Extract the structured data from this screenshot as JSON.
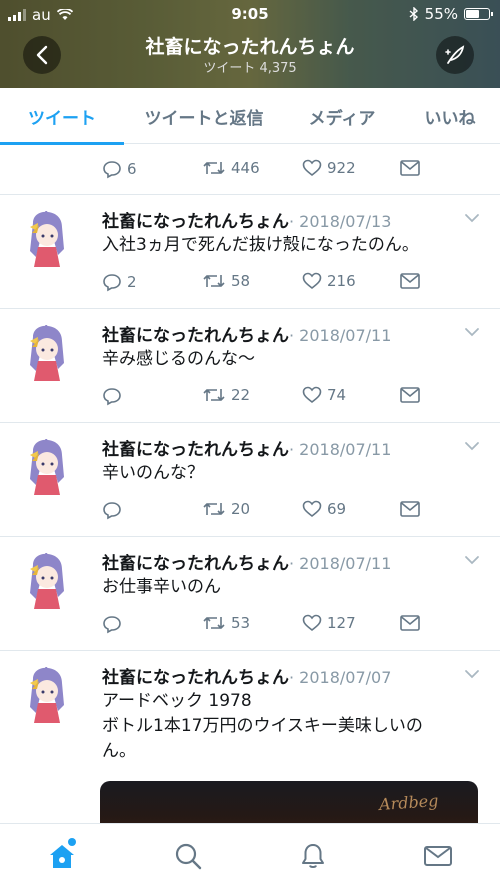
{
  "status_bar": {
    "carrier": "au",
    "time": "9:05",
    "battery": "55%"
  },
  "header": {
    "title": "社畜になったれんちょん",
    "subtitle": "ツイート 4,375"
  },
  "tabs": [
    {
      "label": "ツイート",
      "active": true
    },
    {
      "label": "ツイートと返信",
      "active": false
    },
    {
      "label": "メディア",
      "active": false
    },
    {
      "label": "いいね",
      "active": false
    }
  ],
  "partial_tweet": {
    "replies": "6",
    "retweets": "446",
    "likes": "922"
  },
  "tweets": [
    {
      "name": "社畜になったれんちょん",
      "date": "· 2018/07/13",
      "text": "入社3ヵ月で死んだ抜け殻になったのん。",
      "replies": "2",
      "retweets": "58",
      "likes": "216"
    },
    {
      "name": "社畜になったれんちょん",
      "date": "· 2018/07/11",
      "text": "辛み感じるのんな〜",
      "replies": "",
      "retweets": "22",
      "likes": "74"
    },
    {
      "name": "社畜になったれんちょん",
      "date": "· 2018/07/11",
      "text": "辛いのんな？",
      "replies": "",
      "retweets": "20",
      "likes": "69"
    },
    {
      "name": "社畜になったれんちょん",
      "date": "· 2018/07/11",
      "text": "お仕事辛いのん",
      "replies": "",
      "retweets": "53",
      "likes": "127"
    },
    {
      "name": "社畜になったれんちょん",
      "date": "· 2018/07/07",
      "text_line1": "アードベック 1978",
      "text_line2": "ボトル1本17万円のウイスキー美味しいの",
      "text_line3": "ん。",
      "media_text": "Ardbeg"
    }
  ],
  "colors": {
    "accent": "#1da1f2",
    "muted": "#657786",
    "divider": "#e1e8ed"
  },
  "icons": {
    "home": "home-icon",
    "search": "search-icon",
    "notifications": "bell-icon",
    "messages": "envelope-icon"
  }
}
